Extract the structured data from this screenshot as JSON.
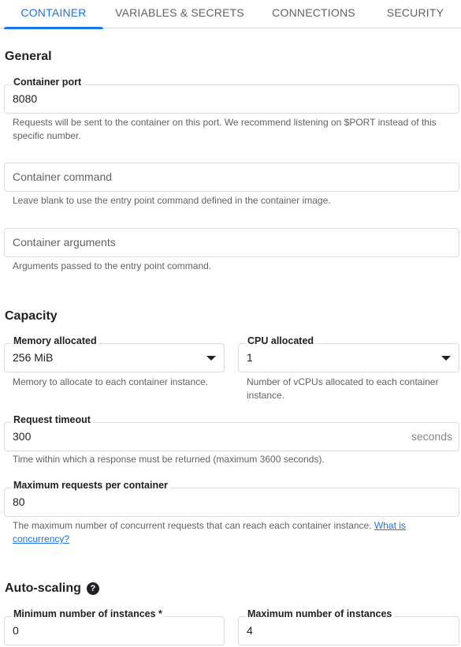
{
  "tabs": [
    {
      "label": "CONTAINER",
      "active": true
    },
    {
      "label": "VARIABLES & SECRETS",
      "active": false
    },
    {
      "label": "CONNECTIONS",
      "active": false
    },
    {
      "label": "SECURITY",
      "active": false
    }
  ],
  "general": {
    "title": "General",
    "container_port": {
      "label": "Container port",
      "value": "8080",
      "hint": "Requests will be sent to the container on this port. We recommend listening on $PORT instead of this specific number."
    },
    "container_command": {
      "placeholder": "Container command",
      "hint": "Leave blank to use the entry point command defined in the container image."
    },
    "container_arguments": {
      "placeholder": "Container arguments",
      "hint": "Arguments passed to the entry point command."
    }
  },
  "capacity": {
    "title": "Capacity",
    "memory": {
      "label": "Memory allocated",
      "value": "256 MiB",
      "hint": "Memory to allocate to each container instance."
    },
    "cpu": {
      "label": "CPU allocated",
      "value": "1",
      "hint": "Number of vCPUs allocated to each container instance."
    },
    "request_timeout": {
      "label": "Request timeout",
      "value": "300",
      "suffix": "seconds",
      "hint": "Time within which a response must be returned (maximum 3600 seconds)."
    },
    "max_requests": {
      "label": "Maximum requests per container",
      "value": "80",
      "hint": "The maximum number of concurrent requests that can reach each container instance.",
      "link": "What is concurrency?"
    }
  },
  "autoscaling": {
    "title": "Auto-scaling",
    "help_icon": "help-circle-icon",
    "min_instances": {
      "label": "Minimum number of instances *",
      "value": "0"
    },
    "max_instances": {
      "label": "Maximum number of instances",
      "value": "4"
    }
  },
  "colors": {
    "accent": "#1a73e8",
    "border": "#dadce0",
    "hint_text": "#5f6368"
  }
}
